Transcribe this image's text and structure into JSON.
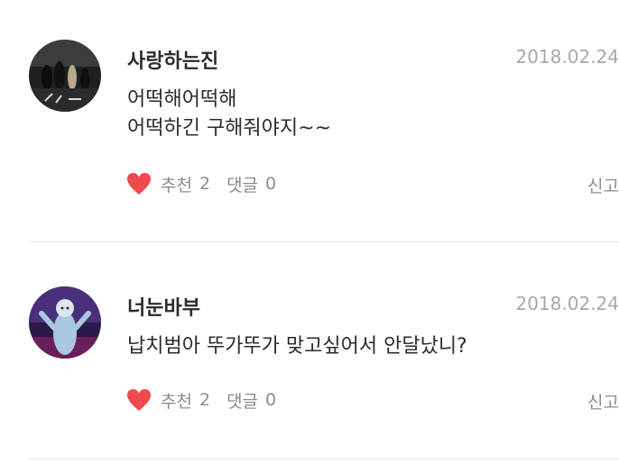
{
  "comments": [
    {
      "username": "사랑하는진",
      "date": "2018.02.24",
      "text": "어떡해어떡해\n어떡하긴 구해줘야지~~",
      "recommend_label": "추천",
      "recommend_count": "2",
      "reply_label": "댓글",
      "reply_count": "0",
      "report_label": "신고",
      "avatar_icon": "avatar-photo-icon",
      "heart_color": "#ee4a4f"
    },
    {
      "username": "너눈바부",
      "date": "2018.02.24",
      "text": "납치범아 뚜가뚜가 맞고싶어서 안달났니?",
      "recommend_label": "추천",
      "recommend_count": "2",
      "reply_label": "댓글",
      "reply_count": "0",
      "report_label": "신고",
      "avatar_icon": "avatar-photo-icon",
      "heart_color": "#ee4a4f"
    }
  ]
}
